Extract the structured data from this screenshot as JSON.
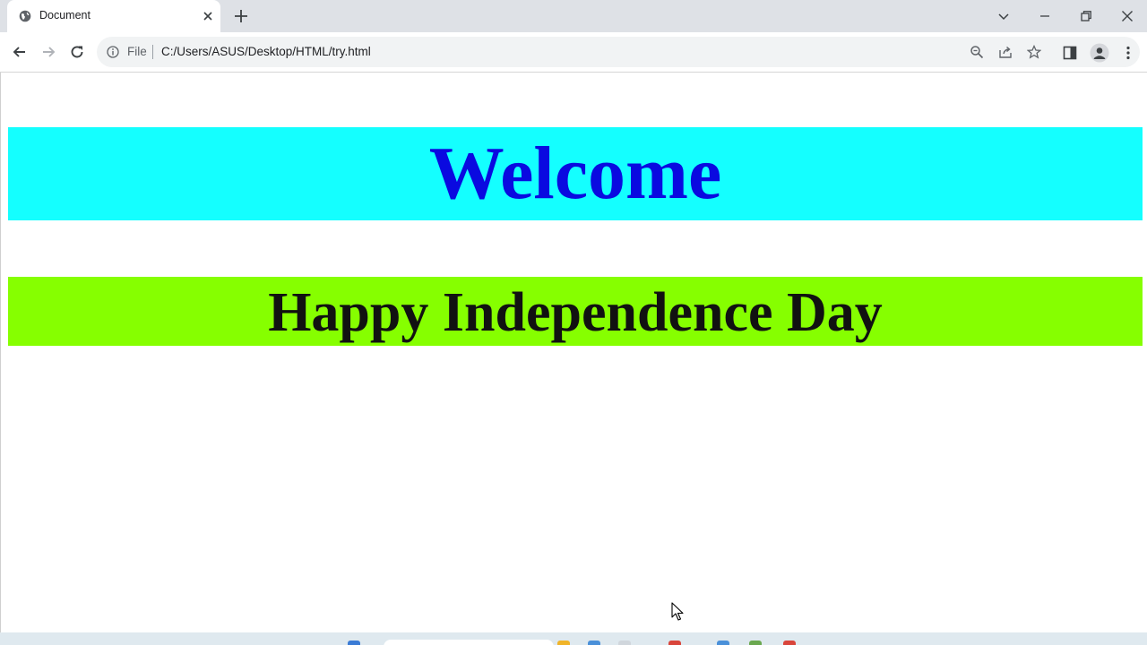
{
  "browser": {
    "tab": {
      "title": "Document"
    },
    "address_bar": {
      "scheme_label": "File",
      "url": "C:/Users/ASUS/Desktop/HTML/try.html"
    },
    "icons": {
      "favicon": "globe-icon",
      "tab_close": "close-icon",
      "new_tab": "plus-icon",
      "tab_search": "chevron-down-icon",
      "minimize": "minimize-icon",
      "restore": "restore-icon",
      "close_window": "close-icon",
      "back": "back-arrow-icon",
      "forward": "forward-arrow-icon",
      "reload": "reload-icon",
      "site_info": "info-icon",
      "zoom": "zoom-icon",
      "share": "share-icon",
      "bookmark": "star-icon",
      "side_panel": "side-panel-icon",
      "profile": "profile-icon",
      "menu": "kebab-menu-icon"
    }
  },
  "page": {
    "welcome": {
      "text": "Welcome",
      "background": "#14ffff",
      "color": "#0a0ae0"
    },
    "holiday": {
      "text": "Happy Independence Day",
      "background": "#86ff00",
      "color": "#111111"
    }
  }
}
